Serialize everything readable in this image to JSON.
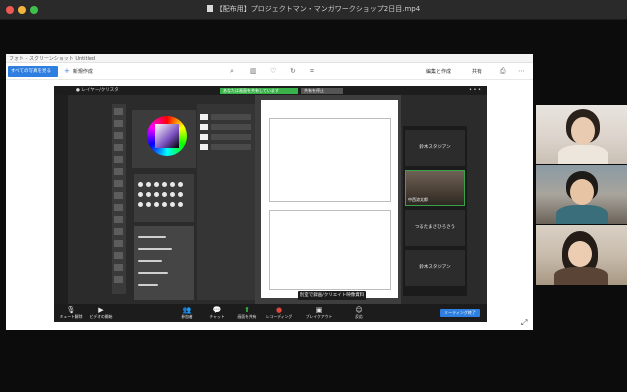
{
  "mac_window": {
    "title": "【配布用】プロジェクトマン・マンガワークショップ2日目.mp4"
  },
  "app": {
    "title": "フォト - スクリーンショット Untitled",
    "toolbar": {
      "open_label": "すべての写真を見る",
      "new_label": "新規作成",
      "edit_label": "編集と作成",
      "share_label": "共有",
      "icons": [
        "zoom-icon",
        "delete-icon",
        "favorite-icon",
        "rotate-icon",
        "crop-icon",
        "print-icon",
        "more-icon"
      ]
    }
  },
  "share": {
    "tab_label": "● レイヤー/クリスタ",
    "green_banner": "あなたは画面を共有しています",
    "gray_button": "共有を停止",
    "dots": "• • •",
    "rec_box": "別室で録画/クリエイト映像資料"
  },
  "participants": [
    {
      "name": "鈴木スタジアン"
    },
    {
      "name": "中西涼太郎"
    },
    {
      "name": "つるたまさひろさう"
    },
    {
      "name": "鈴木スタジアン"
    }
  ],
  "controls": {
    "items": [
      {
        "icon": "🎙",
        "label": "ミュート解除"
      },
      {
        "icon": "▶",
        "label": "ビデオの開始"
      },
      {
        "icon": "👥",
        "label": "参加者"
      },
      {
        "icon": "💬",
        "label": "チャット"
      },
      {
        "icon": "⬆",
        "label": "画面を共有"
      },
      {
        "icon": "●",
        "label": "レコーディング"
      },
      {
        "icon": "▣",
        "label": "ブレイクアウト"
      },
      {
        "icon": "☺",
        "label": "反応"
      }
    ],
    "end_label": "ミーティング終了"
  },
  "colors": {
    "accent_blue": "#2f7fe0",
    "zoom_green": "#3ab34a"
  }
}
